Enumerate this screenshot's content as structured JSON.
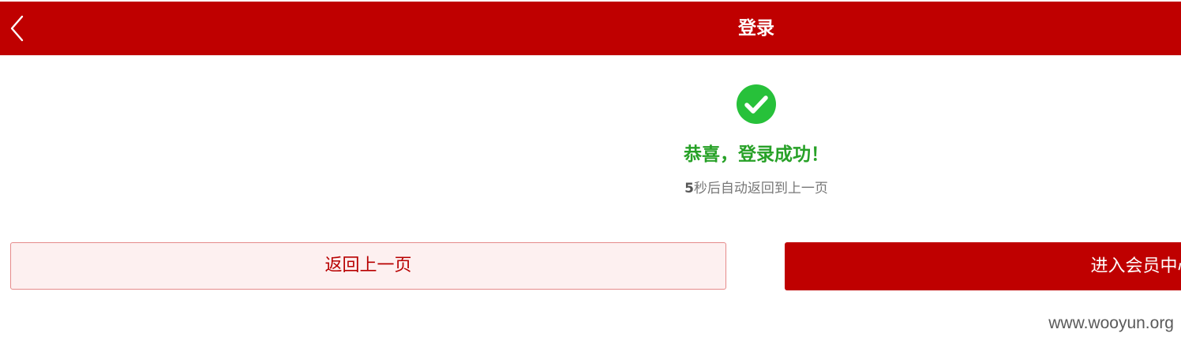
{
  "header": {
    "title": "登录",
    "back_icon": "chevron-left-icon",
    "background_color": "#bf0000"
  },
  "result": {
    "icon": "check-circle-icon",
    "icon_color": "#27c13a",
    "title": "恭喜，登录成功！",
    "title_color": "#27a127",
    "countdown_seconds": "5",
    "countdown_text": "秒后自动返回到上一页"
  },
  "actions": {
    "back_label": "返回上一页",
    "member_center_label": "进入会员中心"
  },
  "watermark": "www.wooyun.org"
}
